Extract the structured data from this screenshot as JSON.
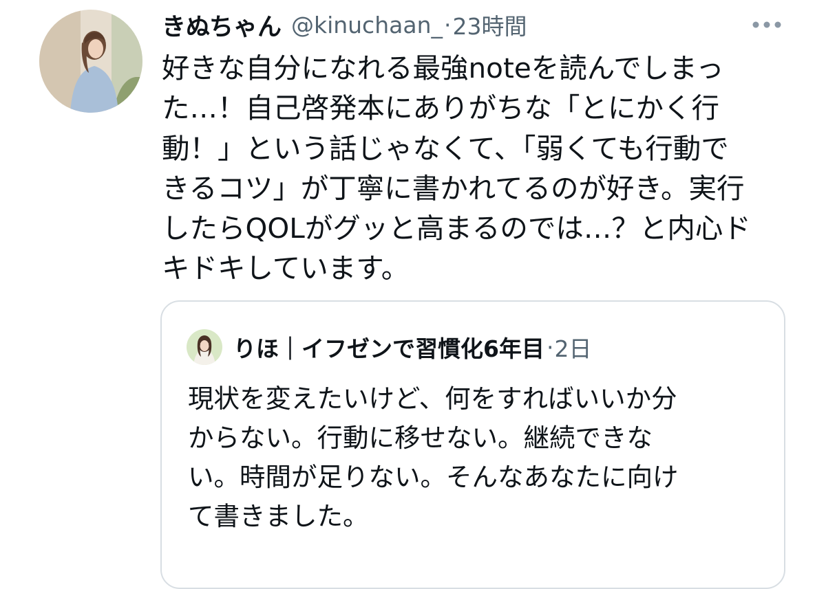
{
  "tweet": {
    "avatar_icon": "profile-photo",
    "display_name": "きぬちゃん",
    "handle": "@kinuchaan_",
    "separator": "·",
    "time": "23時間",
    "more_icon": "more-horizontal-icon",
    "text_lines": [
      "好きな自分になれる最強noteを読んでしまっ",
      "た…！自己啓発本にありがちな「とにかく行",
      "動！」という話じゃなくて、「弱くても行動で",
      "きるコツ」が丁寧に書かれてるのが好き。実行",
      "したらQOLがグッと高まるのでは…？と内心ド",
      "キドキしています。"
    ]
  },
  "quote": {
    "avatar_icon": "profile-photo",
    "display_name": "りほ｜イフゼンで習慣化6年目",
    "separator": "·",
    "time": "2日",
    "text_lines": [
      "現状を変えたいけど、何をすればいいか分",
      "からない。行動に移せない。継続できな",
      "い。時間が足りない。そんなあなたに向け",
      "て書きました。"
    ]
  },
  "colors": {
    "text": "#0f1419",
    "secondary": "#536471",
    "border": "#d8dee3"
  }
}
